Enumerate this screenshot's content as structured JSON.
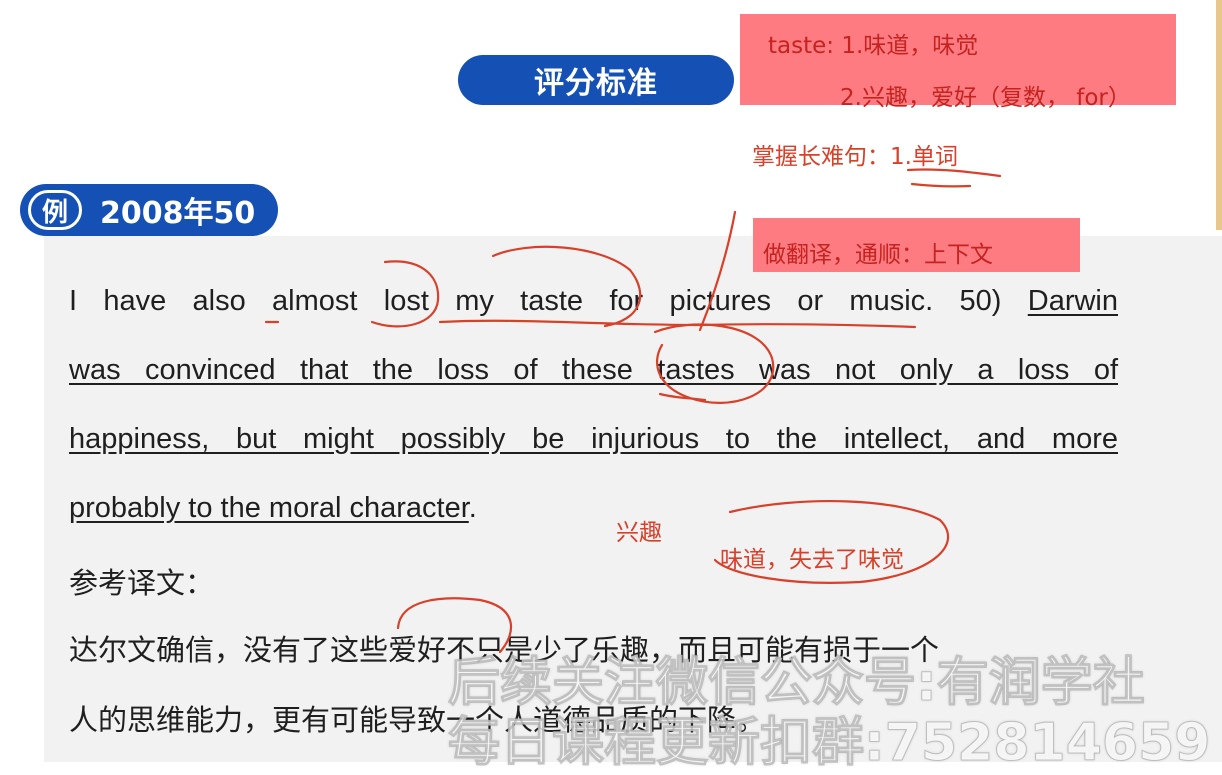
{
  "header": {
    "title": "评分标准",
    "example_badge": "例",
    "example_label": "2008年50"
  },
  "notes": {
    "taste_line1": "taste: 1.味道，味觉",
    "taste_line2": "2.兴趣，爱好（复数， for）",
    "master_long_sentence": "掌握长难句：1.单词",
    "translate_tip": "做翻译，通顺：上下文",
    "interest": "兴趣",
    "taste_lost": "味道，失去了味觉"
  },
  "passage": {
    "line1_plain": "I have also almost lost my taste for pictures or music. 50)",
    "line1_underlined": "Darwin",
    "line2": "was convinced that the loss of these tastes was not only a loss of",
    "line3": "happiness, but might possibly be injurious to the intellect, and more",
    "line4_underlined": "probably to the moral character",
    "line4_end": "."
  },
  "translation": {
    "label": "参考译文：",
    "line1": "达尔文确信，没有了这些爱好不只是少了乐趣，而且可能有损于一个",
    "line2": "人的思维能力，更有可能导致一个人道德品质的下降。"
  },
  "watermark": {
    "line1": "后续关注微信公众号:有润学社",
    "line2": "每日课程更新扣群:752814659"
  },
  "colors": {
    "accent_blue": "#1551b5",
    "note_box": "#ff7b82",
    "note_text": "#c4231f",
    "annotation_red": "#d8402a"
  }
}
